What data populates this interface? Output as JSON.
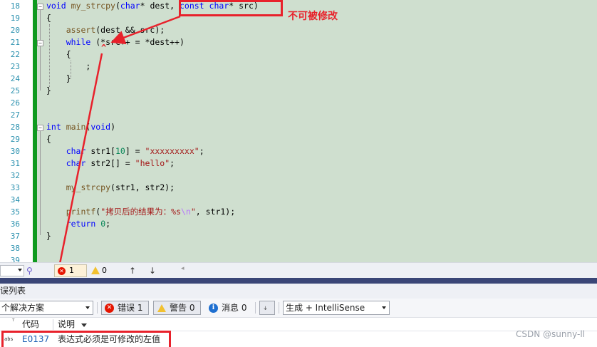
{
  "editor": {
    "lines": [
      {
        "n": "18",
        "html": "<span class=\"kw\">void</span> <span class=\"fn\">my_strcpy</span>(<span class=\"kw\">char</span>* dest, <span class=\"kw\">const</span> <span class=\"kw\">char</span>* src)"
      },
      {
        "n": "19",
        "html": "{"
      },
      {
        "n": "20",
        "html": "    <span class=\"fn\">assert</span>(dest &amp;&amp; src);"
      },
      {
        "n": "21",
        "html": "    <span class=\"kw\">while</span> (*src++ = *dest++)"
      },
      {
        "n": "22",
        "html": "    {"
      },
      {
        "n": "23",
        "html": "        ;"
      },
      {
        "n": "24",
        "html": "    }"
      },
      {
        "n": "25",
        "html": "}"
      },
      {
        "n": "26",
        "html": ""
      },
      {
        "n": "27",
        "html": ""
      },
      {
        "n": "28",
        "html": "<span class=\"kw\">int</span> <span class=\"fn\">main</span>(<span class=\"kw\">void</span>)"
      },
      {
        "n": "29",
        "html": "{"
      },
      {
        "n": "30",
        "html": "    <span class=\"kw\">char</span> str1[<span class=\"num\">10</span>] = <span class=\"str\">\"xxxxxxxxx\"</span>;"
      },
      {
        "n": "31",
        "html": "    <span class=\"kw\">char</span> str2[] = <span class=\"str\">\"hello\"</span>;"
      },
      {
        "n": "32",
        "html": ""
      },
      {
        "n": "33",
        "html": "    <span class=\"fn\">my_strcpy</span>(str1, str2);"
      },
      {
        "n": "34",
        "html": ""
      },
      {
        "n": "35",
        "html": "    <span class=\"fn\">printf</span>(<span class=\"str\">\"拷贝后的结果为：%s</span><span class=\"esc\">\\n</span><span class=\"str\">\"</span>, str1);"
      },
      {
        "n": "36",
        "html": "    <span class=\"kw\">return</span> <span class=\"num\">0</span>;"
      },
      {
        "n": "37",
        "html": "}"
      },
      {
        "n": "38",
        "html": ""
      },
      {
        "n": "39",
        "html": ""
      }
    ],
    "annotation_text": "不可被修改",
    "squiggle": "^"
  },
  "strip": {
    "error_count": "1",
    "warning_count": "0",
    "up_arrow": "↑",
    "down_arrow": "↓"
  },
  "panel": {
    "title": "误列表",
    "scope_combo": "个解决方案",
    "errors_label": "错误 1",
    "warnings_label": "警告 0",
    "messages_label": "消息 0",
    "source_combo": "生成 + IntelliSense",
    "columns": {
      "code": "代码",
      "description": "说明"
    },
    "rows": [
      {
        "icon": "abs",
        "code": "E0137",
        "description": "表达式必须是可修改的左值"
      }
    ]
  },
  "watermark": "CSDN @sunny-ll",
  "colors": {
    "annotation": "#e8212b",
    "keyword": "#0000ff",
    "string": "#a31515",
    "editor_bg": "#cfdfcf"
  }
}
